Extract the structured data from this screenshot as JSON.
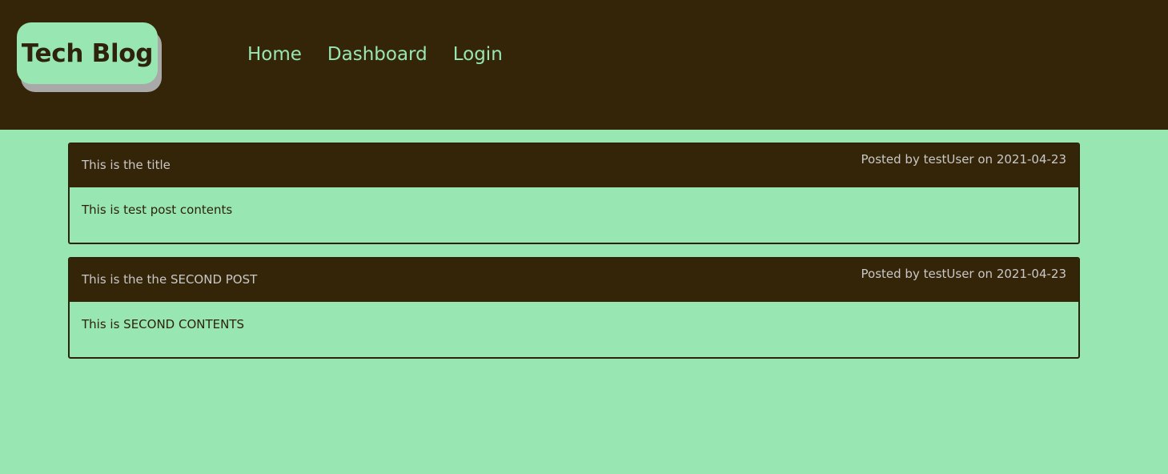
{
  "header": {
    "brand": "Tech Blog",
    "nav": [
      "Home",
      "Dashboard",
      "Login"
    ]
  },
  "posts": [
    {
      "title": "This is the title",
      "meta": "Posted by testUser on 2021-04-23",
      "content": "This is test post contents"
    },
    {
      "title": "This is the the SECOND POST",
      "meta": "Posted by testUser on 2021-04-23",
      "content": "This is SECOND CONTENTS"
    }
  ],
  "colors": {
    "header_background": "#352508",
    "page_background": "#98e6b2",
    "accent_text": "#98e6b2",
    "card_header_text": "#c8c8c8"
  }
}
